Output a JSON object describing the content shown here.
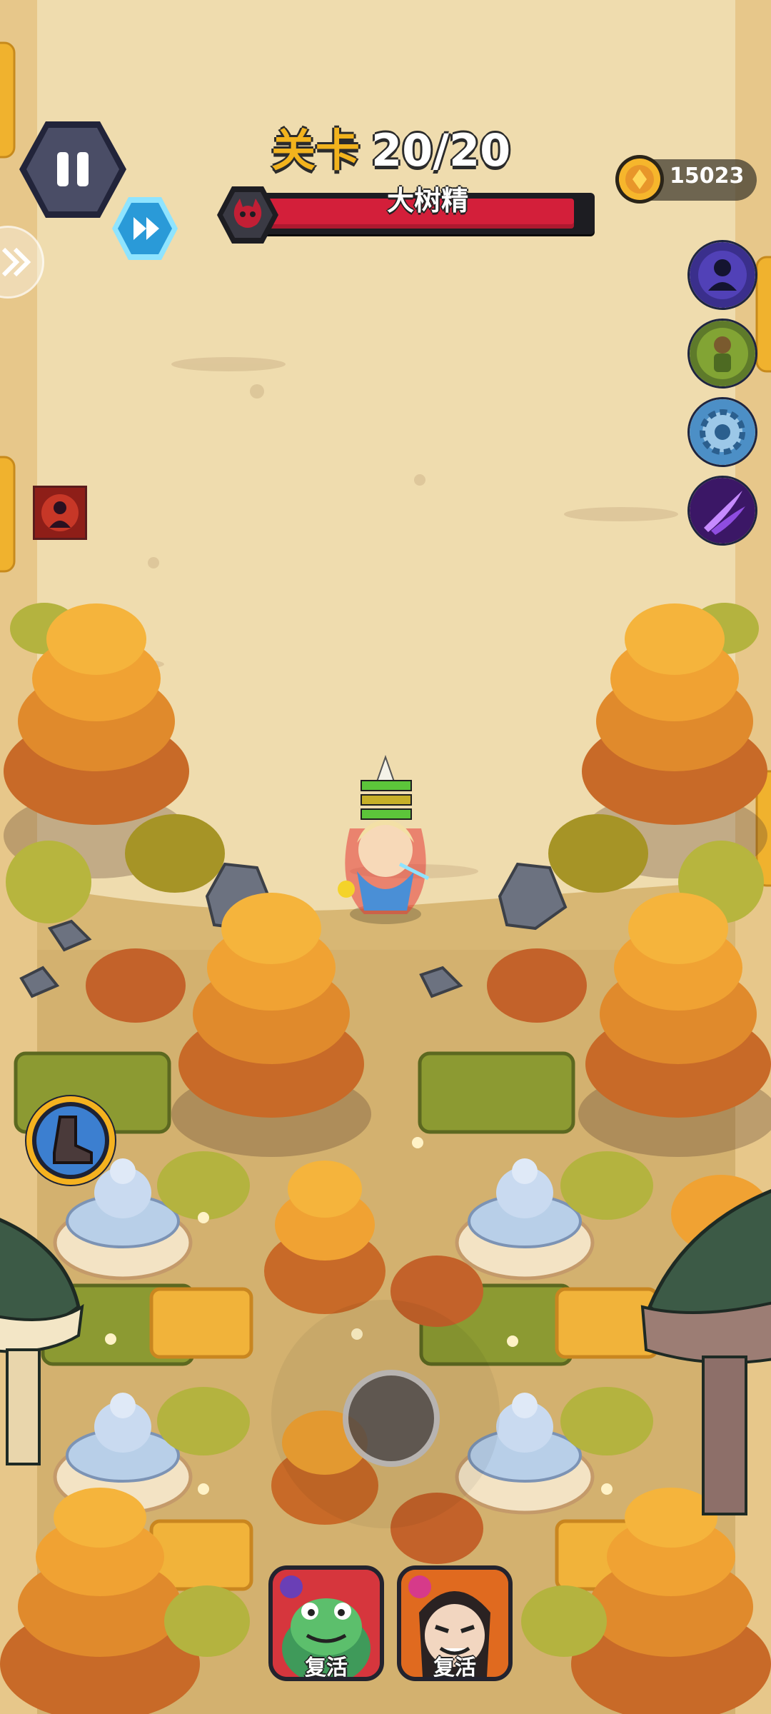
{
  "hud": {
    "level_label": "关卡",
    "level_value": "20/20",
    "boss_name": "大树精",
    "boss_health_fraction": 0.95,
    "coins": "15023"
  },
  "skills": [
    {
      "name": "shadow-figure-skill-icon",
      "color": "#3a2f8c"
    },
    {
      "name": "poison-warrior-skill-icon",
      "color": "#5e7a2a"
    },
    {
      "name": "gear-skill-icon",
      "color": "#4c8fc6"
    },
    {
      "name": "purple-slash-skill-icon",
      "color": "#6a2bb0"
    }
  ],
  "buffs": [
    {
      "name": "rage-buff-icon",
      "color": "#8e1e18"
    }
  ],
  "revive": [
    {
      "label": "复活",
      "icon": "frog-hero-portrait",
      "color": "#d6363d"
    },
    {
      "label": "复活",
      "icon": "samurai-hero-portrait",
      "color": "#e06a1f"
    }
  ],
  "colors": {
    "ground": "#efdcae",
    "grass": "#d9b66a",
    "boss_bar": "#d31f3a",
    "accent_gold": "#f2b31d"
  }
}
